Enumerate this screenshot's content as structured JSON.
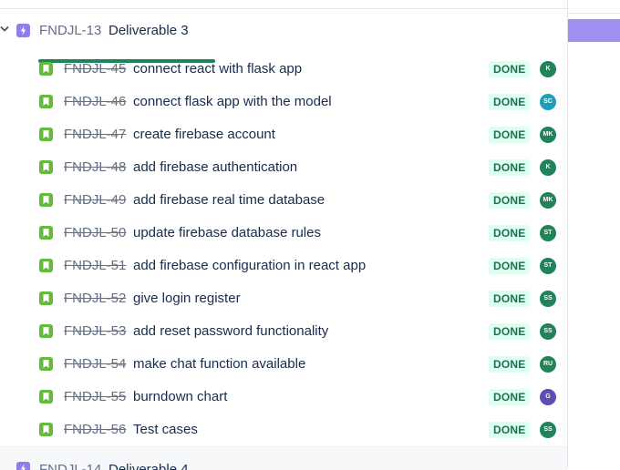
{
  "epic": {
    "key": "FNDJL-13",
    "title": "Deliverable 3",
    "progress_fraction": 1.0,
    "colors": {
      "epic_icon": "#8f7ee7",
      "progress": "#1f845a"
    }
  },
  "next_epic": {
    "key": "FNDJL-14",
    "title": "Deliverable 4"
  },
  "issues": [
    {
      "key": "FNDJL-45",
      "summary": "connect react with flask app",
      "status": "DONE",
      "assignee": "K",
      "avatar_color": "#1f845a"
    },
    {
      "key": "FNDJL-46",
      "summary": "connect flask app with the model",
      "status": "DONE",
      "assignee": "SC",
      "avatar_color": "#1d9fb7"
    },
    {
      "key": "FNDJL-47",
      "summary": "create firebase account",
      "status": "DONE",
      "assignee": "MK",
      "avatar_color": "#1f845a"
    },
    {
      "key": "FNDJL-48",
      "summary": "add firebase authentication",
      "status": "DONE",
      "assignee": "K",
      "avatar_color": "#1f845a"
    },
    {
      "key": "FNDJL-49",
      "summary": "add firebase real time database",
      "status": "DONE",
      "assignee": "MK",
      "avatar_color": "#1f845a"
    },
    {
      "key": "FNDJL-50",
      "summary": "update firebase database rules",
      "status": "DONE",
      "assignee": "ST",
      "avatar_color": "#1f845a"
    },
    {
      "key": "FNDJL-51",
      "summary": "add firebase configuration in react app",
      "status": "DONE",
      "assignee": "ST",
      "avatar_color": "#1f845a"
    },
    {
      "key": "FNDJL-52",
      "summary": "give login register",
      "status": "DONE",
      "assignee": "SS",
      "avatar_color": "#1f845a"
    },
    {
      "key": "FNDJL-53",
      "summary": "add reset password functionality",
      "status": "DONE",
      "assignee": "SS",
      "avatar_color": "#1f845a"
    },
    {
      "key": "FNDJL-54",
      "summary": "make chat function available",
      "status": "DONE",
      "assignee": "RU",
      "avatar_color": "#1f845a"
    },
    {
      "key": "FNDJL-55",
      "summary": "burndown chart",
      "status": "DONE",
      "assignee": "G",
      "avatar_color": "#5e4db2"
    },
    {
      "key": "FNDJL-56",
      "summary": "Test cases",
      "status": "DONE",
      "assignee": "SS",
      "avatar_color": "#1f845a"
    }
  ],
  "icons": {
    "collapse": "chevron-down-icon",
    "epic": "epic-lightning-icon",
    "story": "story-bookmark-icon"
  },
  "colors": {
    "story_icon": "#63ba3c",
    "status_bg": "#dcfff1",
    "status_text": "#216e4e"
  }
}
